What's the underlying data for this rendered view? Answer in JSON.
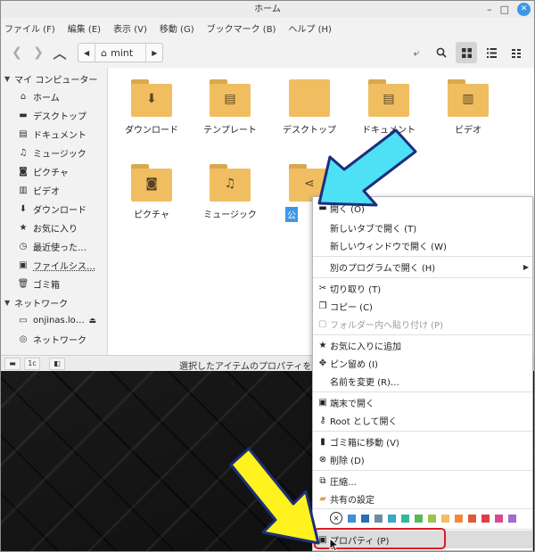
{
  "window": {
    "title": "ホーム",
    "controls": {
      "minimize": "–",
      "maximize": "□",
      "close": "✕"
    }
  },
  "menubar": [
    "ファイル (F)",
    "編集 (E)",
    "表示 (V)",
    "移動 (G)",
    "ブックマーク (B)",
    "ヘルプ (H)"
  ],
  "toolbar": {
    "back_icon": "chevron-left-icon",
    "forward_icon": "chevron-right-icon",
    "up_icon": "chevron-up-icon",
    "path_toggle_icon": "chevron-left-icon",
    "path_crumb": "mint",
    "path_next_icon": "chevron-right-icon",
    "right_icons": [
      "toggle-location-icon",
      "search-icon",
      "grid-view-icon",
      "list-view-icon",
      "compact-view-icon"
    ],
    "active_view": "grid-view-icon"
  },
  "sidebar": {
    "sections": [
      {
        "header": "マイ コンピューター",
        "items": [
          {
            "label": "ホーム",
            "icon": "home-icon"
          },
          {
            "label": "デスクトップ",
            "icon": "desktop-icon"
          },
          {
            "label": "ドキュメント",
            "icon": "document-icon"
          },
          {
            "label": "ミュージック",
            "icon": "music-icon"
          },
          {
            "label": "ピクチャ",
            "icon": "camera-icon"
          },
          {
            "label": "ビデオ",
            "icon": "video-icon"
          },
          {
            "label": "ダウンロード",
            "icon": "download-icon"
          },
          {
            "label": "お気に入り",
            "icon": "star-icon"
          },
          {
            "label": "最近使った…",
            "icon": "clock-icon"
          },
          {
            "label": "ファイルシス…",
            "icon": "drive-icon"
          },
          {
            "label": "ゴミ箱",
            "icon": "trash-icon"
          }
        ]
      },
      {
        "header": "ネットワーク",
        "items": [
          {
            "label": "onjinas.lo…",
            "icon": "network-drive-icon",
            "eject": "⏏"
          },
          {
            "label": "ネットワーク",
            "icon": "network-icon"
          }
        ]
      }
    ]
  },
  "files": [
    {
      "label": "ダウンロード",
      "icon": "download-icon"
    },
    {
      "label": "テンプレート",
      "icon": "document-icon"
    },
    {
      "label": "デスクトップ",
      "icon": "desktop-icon"
    },
    {
      "label": "ドキュメント",
      "icon": "document-icon"
    },
    {
      "label": "ビデオ",
      "icon": "video-icon"
    },
    {
      "label": "ピクチャ",
      "icon": "camera-icon"
    },
    {
      "label": "ミュージック",
      "icon": "music-icon"
    },
    {
      "label": "公",
      "icon": "share-icon",
      "selected": true
    }
  ],
  "statusbar": {
    "buttons": [
      "▬",
      "1c",
      "◧"
    ],
    "text": "選択したアイテムのプロパティを表示・変更"
  },
  "context_menu": {
    "items": [
      {
        "label": "開く (O)",
        "icon": "folder-icon"
      },
      {
        "label": "新しいタブで開く (T)"
      },
      {
        "label": "新しいウィンドウで開く (W)"
      },
      {
        "label": "別のプログラムで開く (H)",
        "submenu": "▶"
      },
      {
        "label": "切り取り (T)",
        "icon": "cut-icon"
      },
      {
        "label": "コピー (C)",
        "icon": "copy-icon"
      },
      {
        "label": "フォルダー内へ貼り付け (P)",
        "icon": "paste-icon",
        "disabled": true
      },
      {
        "label": "お気に入りに追加",
        "icon": "star-icon"
      },
      {
        "label": "ピン留め (I)",
        "icon": "pin-icon"
      },
      {
        "label": "名前を変更 (R)…"
      },
      {
        "label": "端末で開く",
        "icon": "terminal-icon"
      },
      {
        "label": "Root として開く",
        "icon": "key-icon"
      },
      {
        "label": "ゴミ箱に移動 (V)",
        "icon": "trash-icon"
      },
      {
        "label": "削除 (D)",
        "icon": "delete-icon"
      },
      {
        "label": "圧縮…",
        "icon": "compress-icon"
      },
      {
        "label": "共有の設定",
        "icon": "share-folder-icon"
      },
      {
        "label": "プロパティ (P)",
        "icon": "properties-icon",
        "highlighted": true
      }
    ],
    "swatch_colors": [
      "#3f8fd6",
      "#2a6eb8",
      "#6f8aa4",
      "#3aa6c8",
      "#2fb89a",
      "#56b85a",
      "#9ec24d",
      "#f0be61",
      "#ef8a3c",
      "#e0593a",
      "#e03c48",
      "#d94a8e",
      "#a06ad0"
    ]
  },
  "annotations": {
    "red_box_color": "#e0191f",
    "cyan_arrow_color": "#4ee0f5",
    "yellow_arrow_color": "#fff21e"
  }
}
